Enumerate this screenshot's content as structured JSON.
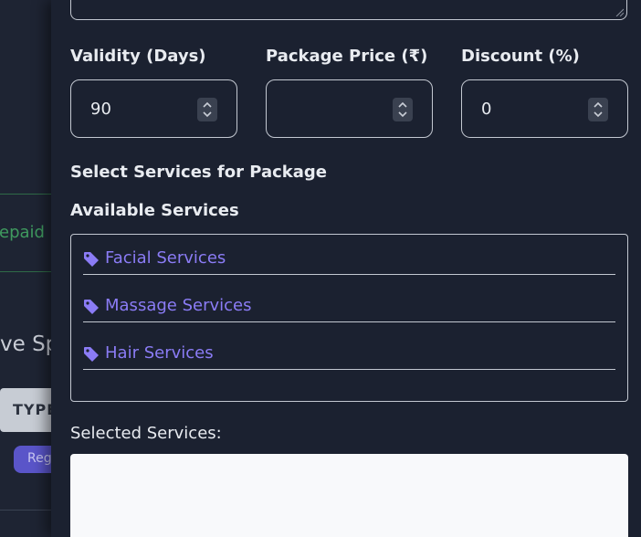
{
  "background": {
    "status_text": "epaid",
    "heading_fragment": "ve Sp",
    "type_column_label": "TYPE",
    "badge_label": "Reg"
  },
  "form": {
    "validity": {
      "label": "Validity (Days)",
      "value": "90"
    },
    "price": {
      "label": "Package Price (₹)",
      "value": ""
    },
    "discount": {
      "label": "Discount (%)",
      "value": "0"
    }
  },
  "services_section": {
    "title": "Select Services for Package",
    "available_title": "Available Services",
    "items": [
      {
        "label": "Facial Services",
        "icon": "tag-icon"
      },
      {
        "label": "Massage Services",
        "icon": "tag-icon"
      },
      {
        "label": "Hair Services",
        "icon": "tag-icon"
      }
    ],
    "selected_title": "Selected Services:"
  },
  "colors": {
    "panel_bg": "#1b2130",
    "accent": "#8b7cf6",
    "border": "#c3c8d1",
    "status_green": "#3f9a5f"
  }
}
